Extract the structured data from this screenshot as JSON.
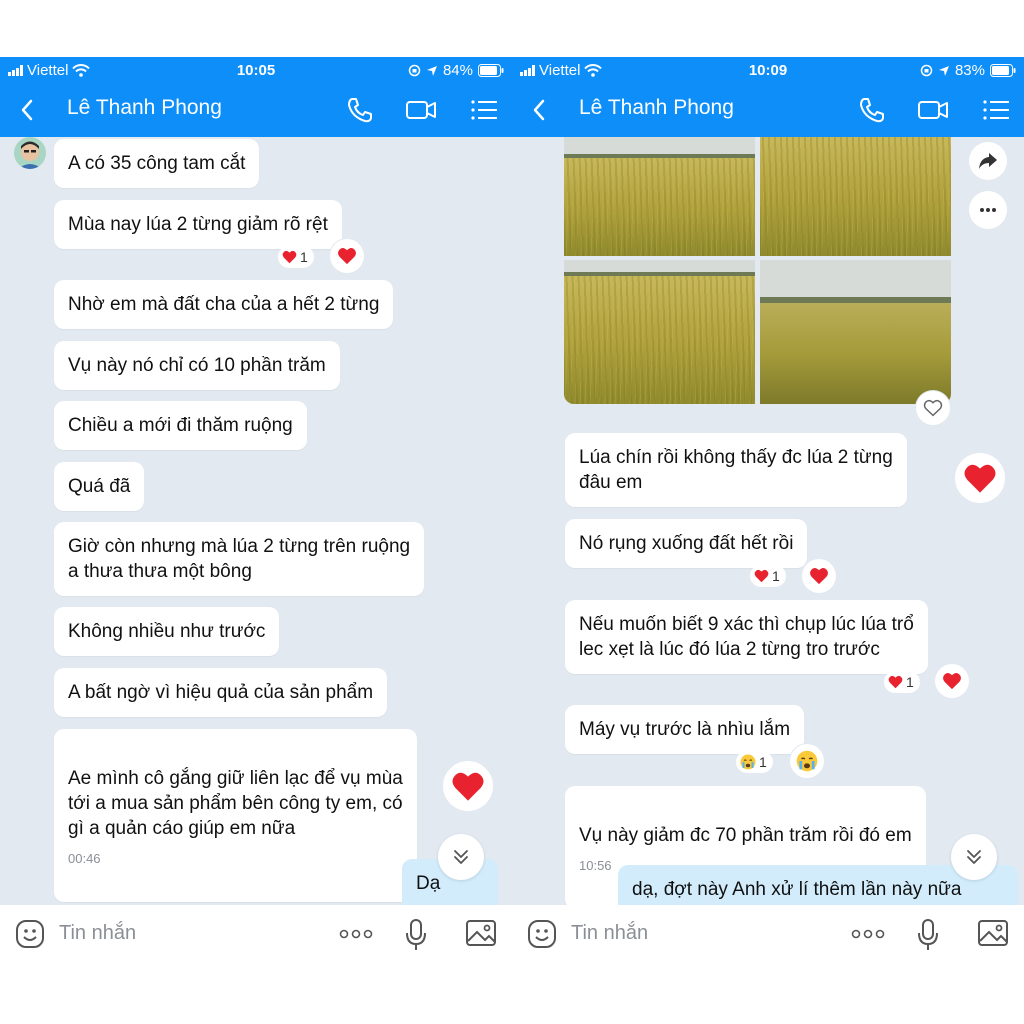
{
  "left": {
    "status": {
      "carrier": "Viettel",
      "time": "10:05",
      "battery": "84%"
    },
    "contact_name": "Lê Thanh Phong",
    "messages": [
      {
        "text": "A có 35 công tam cắt"
      },
      {
        "text": "Mùa nay lúa 2 từng giảm rõ rệt",
        "reaction_count": "1"
      },
      {
        "text": "Nhờ em mà đất cha của a hết 2 từng"
      },
      {
        "text": "Vụ này nó chỉ có 10 phần trăm"
      },
      {
        "text": "Chiều a mới đi thăm ruộng"
      },
      {
        "text": "Quá đã"
      },
      {
        "text": "Giờ còn nhưng mà lúa 2 từng trên ruộng\na thưa thưa một bông"
      },
      {
        "text": "Không nhiều như trước"
      },
      {
        "text": "A bất ngờ vì hiệu quả của sản phẩm"
      },
      {
        "text": "Ae mình cô gắng giữ liên lạc để vụ mùa\ntới a mua sản phẩm bên công ty em, có\ngì a quản cáo giúp em nữa",
        "time": "00:46"
      },
      {
        "text": "Dạ"
      }
    ],
    "input_placeholder": "Tin nhắn"
  },
  "right": {
    "status": {
      "carrier": "Viettel",
      "time": "10:09",
      "battery": "83%"
    },
    "contact_name": "Lê Thanh Phong",
    "messages": [
      {
        "text": "Lúa chín rồi không thấy đc lúa 2 từng\nđâu em"
      },
      {
        "text": "Nó rụng xuống đất hết rồi",
        "reaction_count": "1"
      },
      {
        "text": "Nếu muốn biết 9 xác thì chụp lúc lúa trổ\nlec xẹt là lúc đó lúa 2 từng tro trước",
        "reaction_count": "1"
      },
      {
        "text": "Máy vụ trước là nhìu lắm",
        "reaction_count": "1"
      },
      {
        "text": "Vụ này giảm đc 70 phần trăm rồi đó em",
        "time": "10:56"
      },
      {
        "text": "dạ, đợt này Anh xử lí thêm lần này nữa"
      }
    ],
    "input_placeholder": "Tin nhắn"
  },
  "colors": {
    "header": "#0d8ef9",
    "chat_bg": "#e2e9f1",
    "bubble": "#ffffff",
    "my_bubble": "#d2ecfb",
    "heart": "#e8222e"
  }
}
